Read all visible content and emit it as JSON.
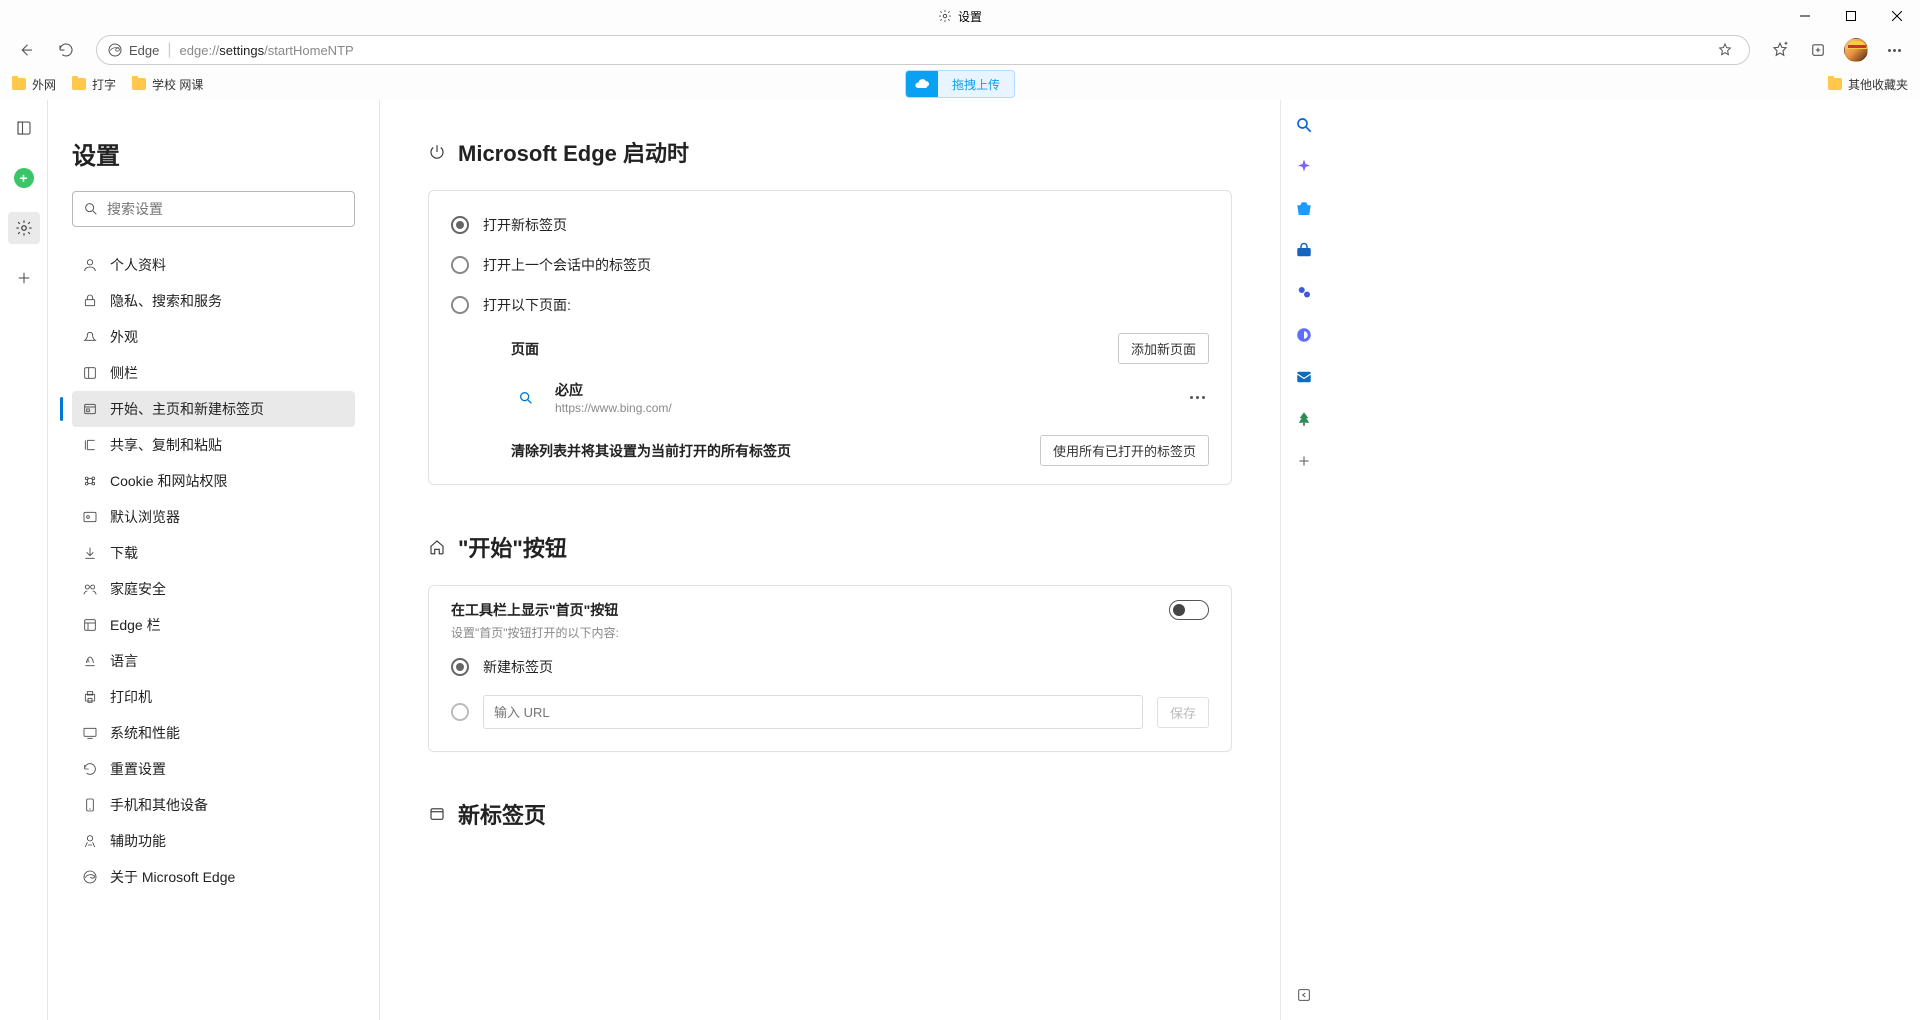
{
  "window": {
    "title": "设置"
  },
  "toolbar": {
    "addr_label": "Edge",
    "url_prefix": "edge://",
    "url_bold": "settings",
    "url_suffix": "/startHomeNTP"
  },
  "bookmarks": {
    "items": [
      "外网",
      "打字",
      "学校 网课"
    ],
    "upload_label": "拖拽上传",
    "other": "其他收藏夹"
  },
  "sidebar": {
    "title": "设置",
    "search_placeholder": "搜索设置",
    "items": [
      "个人资料",
      "隐私、搜索和服务",
      "外观",
      "侧栏",
      "开始、主页和新建标签页",
      "共享、复制和粘贴",
      "Cookie 和网站权限",
      "默认浏览器",
      "下载",
      "家庭安全",
      "Edge 栏",
      "语言",
      "打印机",
      "系统和性能",
      "重置设置",
      "手机和其他设备",
      "辅助功能",
      "关于 Microsoft Edge"
    ]
  },
  "content": {
    "section1": {
      "title": "Microsoft Edge 启动时",
      "radio1": "打开新标签页",
      "radio2": "打开上一个会话中的标签页",
      "radio3": "打开以下页面:",
      "pages_label": "页面",
      "add_page_btn": "添加新页面",
      "page1_name": "必应",
      "page1_url": "https://www.bing.com/",
      "clear_label": "清除列表并将其设置为当前打开的所有标签页",
      "use_all_btn": "使用所有已打开的标签页"
    },
    "section2": {
      "title": "\"开始\"按钮",
      "toggle_title": "在工具栏上显示\"首页\"按钮",
      "toggle_sub": "设置\"首页\"按钮打开的以下内容:",
      "radio1": "新建标签页",
      "url_placeholder": "输入 URL",
      "save_btn": "保存"
    },
    "section3": {
      "title": "新标签页"
    }
  }
}
